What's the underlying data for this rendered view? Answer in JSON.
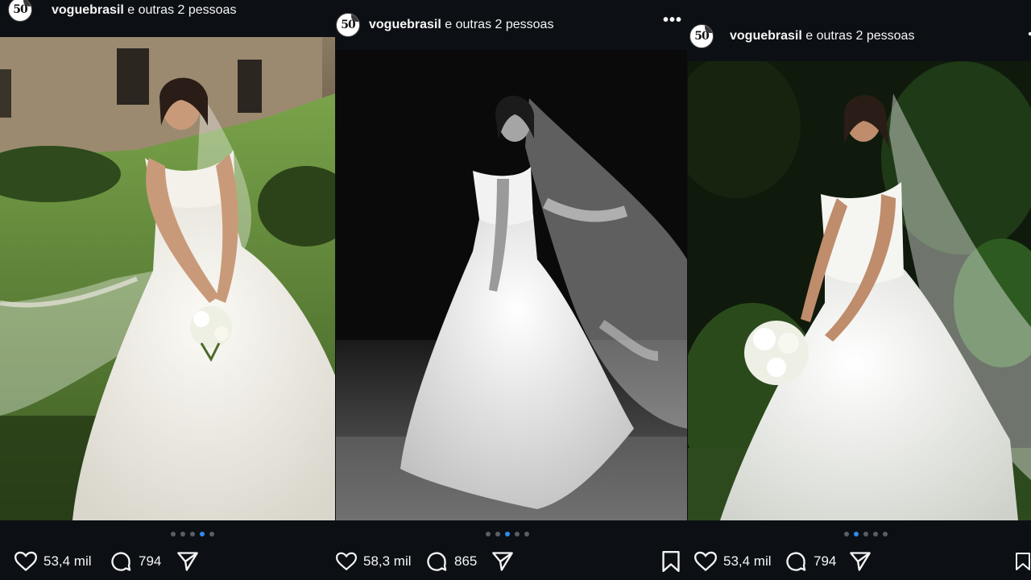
{
  "colors": {
    "background": "#0c1014",
    "text": "#f5f5f5",
    "active_dot": "#2d8cf0",
    "inactive_dot": "#5a5f66"
  },
  "posts": [
    {
      "avatar_text": "50",
      "username": "voguebrasil",
      "collab_text": " e outras 2 pessoas",
      "image_alt": "Bride in off-shoulder ball gown with veil, smiling, in a garden by a stone house",
      "carousel": {
        "total": 5,
        "active": 4
      },
      "likes": "53,4 mil",
      "comments": "794",
      "icons": [
        "heart-icon",
        "comment-icon",
        "share-icon"
      ]
    },
    {
      "avatar_text": "50",
      "username": "voguebrasil",
      "collab_text": " e outras 2 pessoas",
      "more_label": "•••",
      "image_alt": "Black and white photo of bride walking with long lace veil",
      "carousel": {
        "total": 5,
        "active": 3
      },
      "likes": "58,3 mil",
      "comments": "865",
      "icons": [
        "heart-icon",
        "comment-icon",
        "share-icon",
        "bookmark-icon"
      ]
    },
    {
      "avatar_text": "50",
      "username": "voguebrasil",
      "collab_text": " e outras 2 pessoas",
      "image_alt": "Bride holding white bouquet in garden with lush foliage",
      "carousel": {
        "total": 5,
        "active": 2
      },
      "likes": "53,4 mil",
      "comments": "794",
      "icons": [
        "heart-icon",
        "comment-icon",
        "share-icon",
        "bookmark-icon"
      ]
    }
  ]
}
